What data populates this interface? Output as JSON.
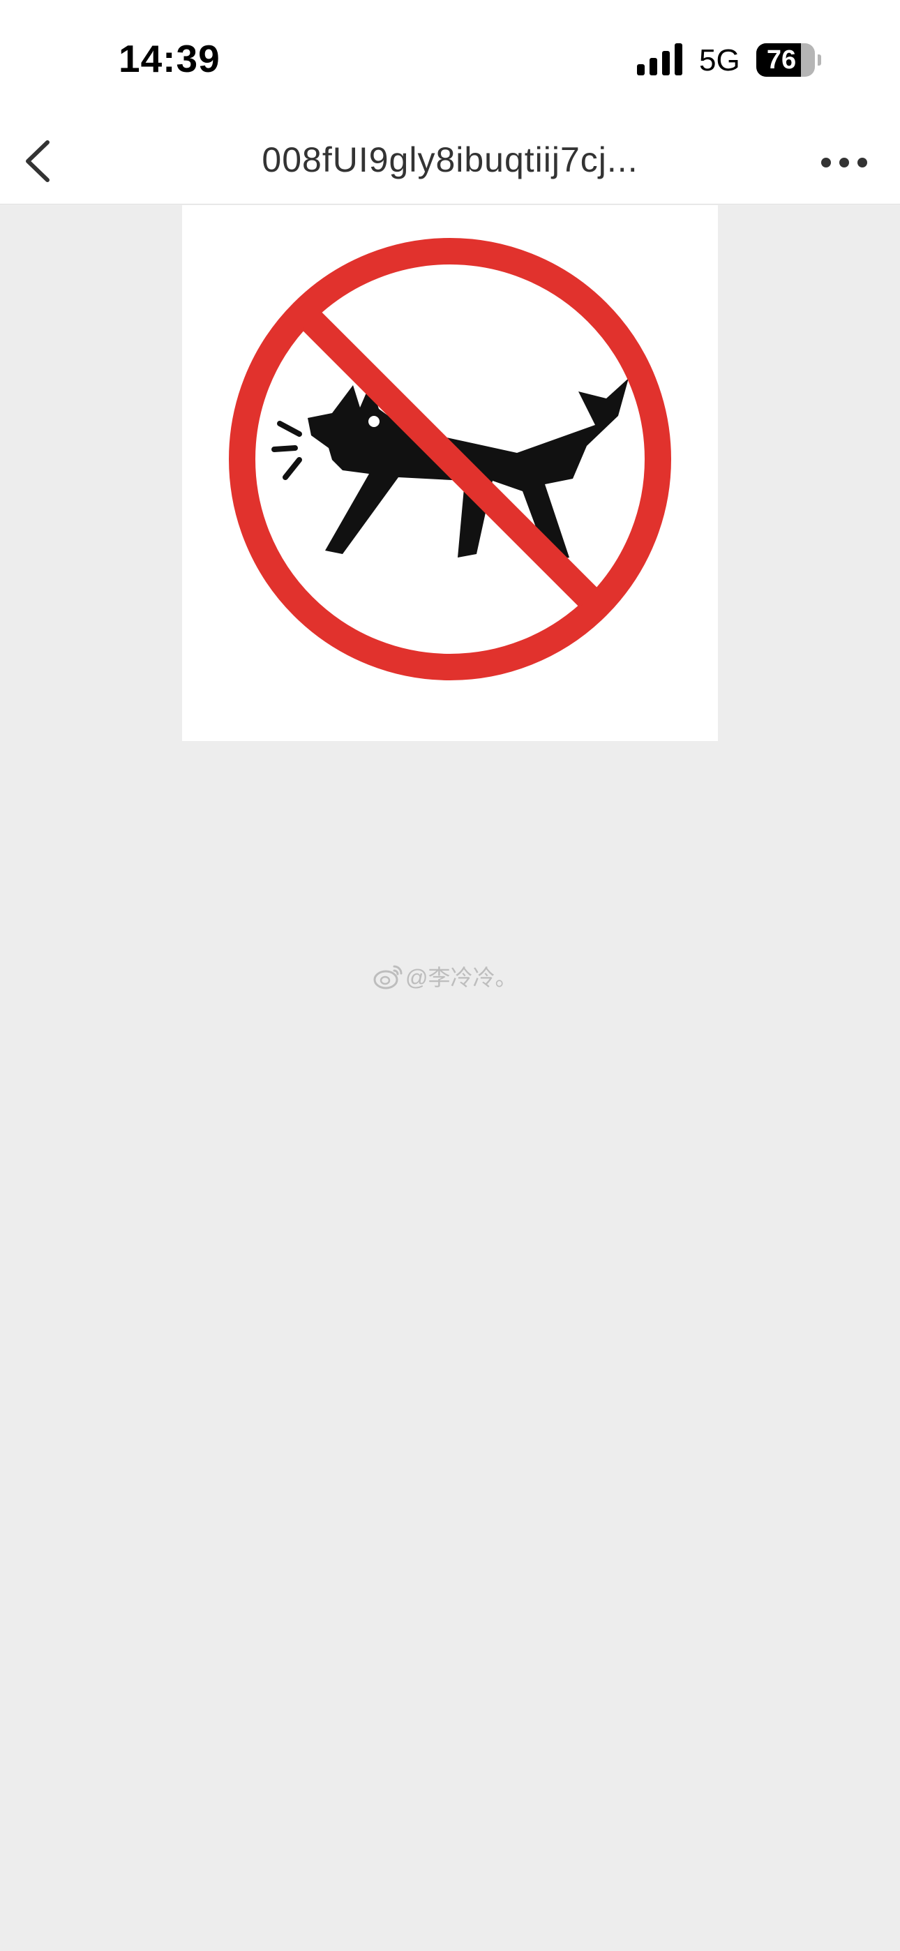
{
  "status_bar": {
    "time": "14:39",
    "network": "5G",
    "battery_percent": "76",
    "battery_level": 0.76
  },
  "nav": {
    "title": "008fUI9gly8ibuqtiij7cj...",
    "back_icon": "chevron-left-icon",
    "more_icon": "more-dots-icon"
  },
  "image": {
    "sign": "no-barking-dog-sign"
  },
  "watermark": {
    "text": "@李冷冷",
    "suffix": "。",
    "icon": "weibo-icon"
  },
  "colors": {
    "background": "#ededed",
    "sign_red": "#e1322d",
    "dog_black": "#111111"
  }
}
